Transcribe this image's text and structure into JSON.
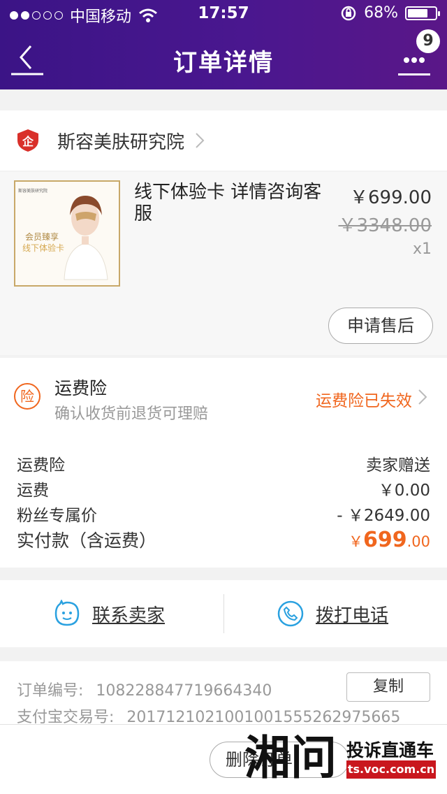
{
  "status_bar": {
    "carrier": "中国移动",
    "time": "17:57",
    "battery": "68%",
    "battery_level": 0.68
  },
  "nav": {
    "title": "订单详情",
    "badge_count": "9",
    "back_icon": "back-arrow-icon",
    "more_icon": "more-dots-icon"
  },
  "shop": {
    "name": "斯容美肤研究院",
    "icon": "enterprise-shop-icon"
  },
  "product": {
    "title": "线下体验卡 详情咨询客服",
    "price": "￥699.00",
    "original_price": "￥3348.00",
    "quantity": "x1",
    "after_sale_label": "申请售后",
    "thumb_brand": "斯容美肤研究院",
    "thumb_line1": "会员臻享",
    "thumb_line2": "线下体验卡"
  },
  "insurance": {
    "icon_text": "险",
    "title": "运费险",
    "subtitle": "确认收货前退货可理赔",
    "status": "运费险已失效"
  },
  "summary": {
    "rows": [
      {
        "label": "运费险",
        "value": "卖家赠送"
      },
      {
        "label": "运费",
        "value": "￥0.00"
      },
      {
        "label": "粉丝专属价",
        "value": "- ￥2649.00"
      }
    ],
    "total_label": "实付款（含运费）",
    "total_currency": "￥",
    "total_int": "699",
    "total_dec": ".00"
  },
  "contact": {
    "seller_label": "联系卖家",
    "phone_label": "拨打电话"
  },
  "order": {
    "order_no_label": "订单编号:",
    "order_no": "108228847719664340",
    "alipay_label": "支付宝交易号:",
    "alipay_no": "2017121021001001555262975665",
    "copy_label": "复制"
  },
  "bottom": {
    "delete_label": "删除订单"
  },
  "watermark": {
    "logo": "湘问",
    "line1": "投诉直通车",
    "line2": "ts.voc.com.cn"
  },
  "colors": {
    "header_start": "#3b1486",
    "header_end": "#5a1788",
    "accent_orange": "#f0661e",
    "shop_red": "#d9302a",
    "contact_blue": "#2aa1e0"
  }
}
